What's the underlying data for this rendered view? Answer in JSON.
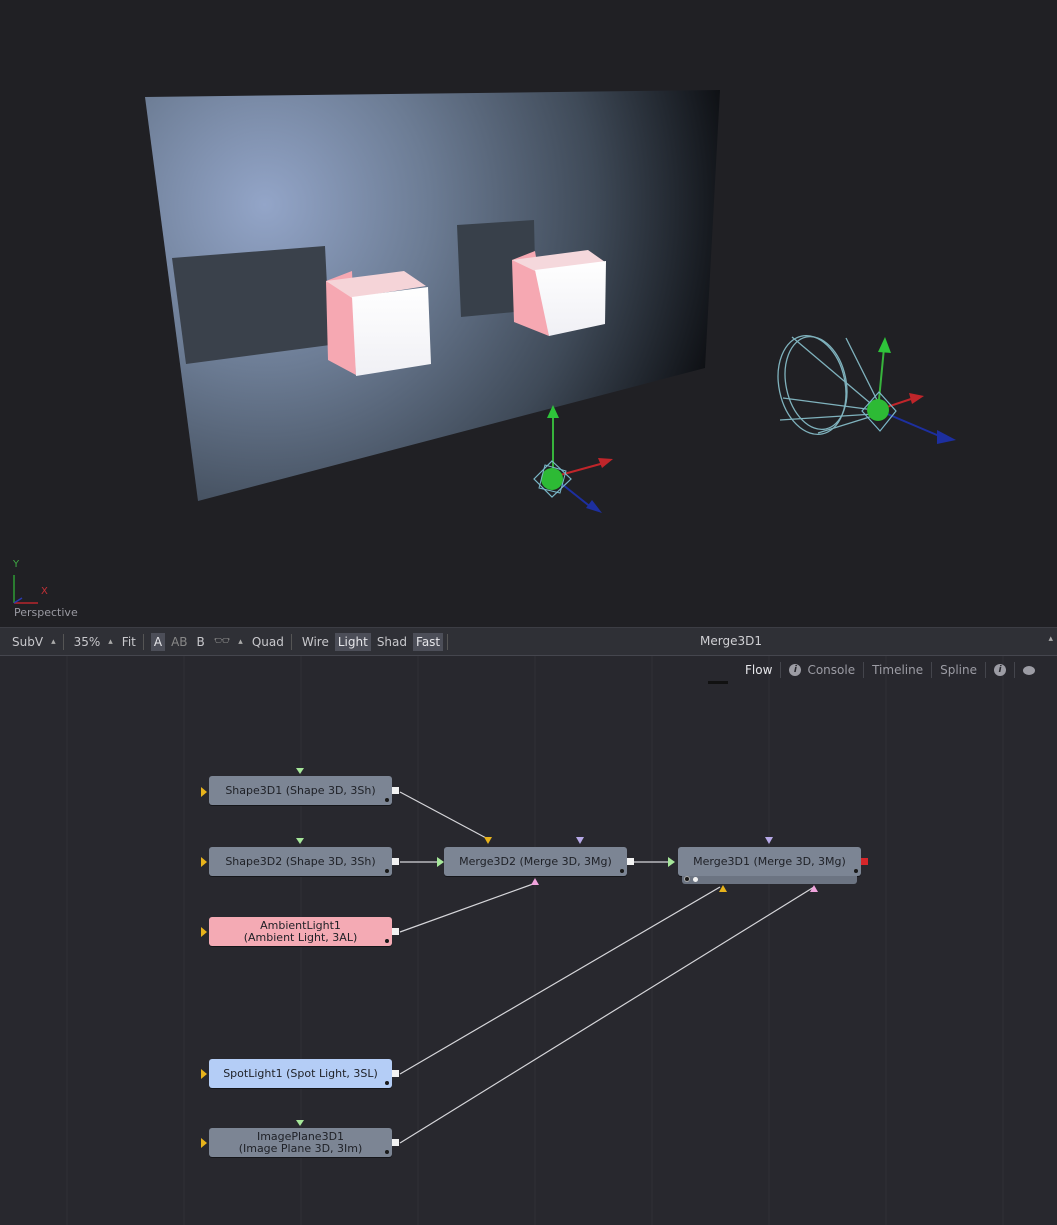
{
  "viewer": {
    "axis_y_label": "Y",
    "axis_x_label": "X",
    "view_name": "Perspective"
  },
  "toolbar": {
    "subview": "SubV",
    "subview_caret": "▴",
    "zoom": "35%",
    "zoom_caret": "▴",
    "fit": "Fit",
    "a": "A",
    "ab": "AB",
    "b": "B",
    "stereo_caret": "▴",
    "quad": "Quad",
    "wire": "Wire",
    "light": "Light",
    "shad": "Shad",
    "fast": "Fast",
    "title": "Merge3D1",
    "caret": "▴"
  },
  "tabs": {
    "flow": "Flow",
    "console": "Console",
    "timeline": "Timeline",
    "spline": "Spline"
  },
  "nodes": {
    "shape1": {
      "label": "Shape3D1  (Shape 3D, 3Sh)"
    },
    "shape2": {
      "label": "Shape3D2  (Shape 3D, 3Sh)"
    },
    "ambient": {
      "line1": "AmbientLight1",
      "line2": "(Ambient Light, 3AL)"
    },
    "spot": {
      "label": "SpotLight1  (Spot Light, 3SL)"
    },
    "image": {
      "line1": "ImagePlane3D1",
      "line2": "(Image Plane 3D, 3Im)"
    },
    "merge2": {
      "label": "Merge3D2  (Merge 3D, 3Mg)"
    },
    "merge1": {
      "label": "Merge3D1  (Merge 3D, 3Mg)"
    }
  },
  "colors": {
    "viewport_bg": "#202024",
    "flow_bg": "#28282e",
    "node_default": "#7c8594",
    "node_ambient": "#f4aab4",
    "node_spot": "#b4cdf6",
    "cube_pink": "#f6a8b2",
    "input_yellow": "#e8b31b",
    "input_green": "#a6e79a",
    "input_violet": "#b7a9e8",
    "input_pink": "#f0a3dc"
  }
}
